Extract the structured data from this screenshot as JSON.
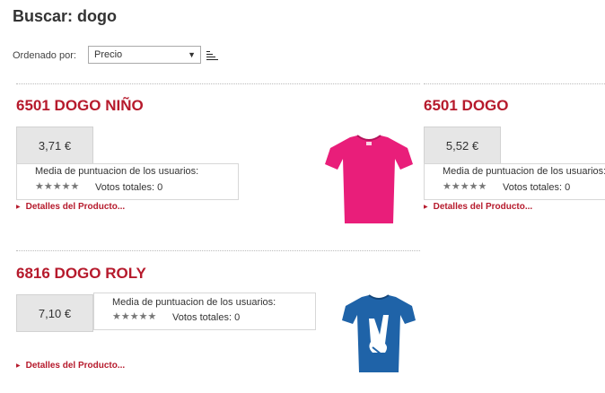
{
  "search": {
    "title": "Buscar: dogo"
  },
  "sort": {
    "label": "Ordenado por:",
    "selected": "Precio"
  },
  "icons": {
    "sort": "sort-order-icon",
    "dropdown": "dropdown-arrow-icon",
    "stars": "rating-stars-icon",
    "bullet": "triangle-bullet-icon"
  },
  "colors": {
    "accent": "#b61a2c",
    "price_bg": "#e6e6e6",
    "shirt_pink": "#e91e7a",
    "shirt_blue": "#1f63a8"
  },
  "products": [
    {
      "name": "6501 DOGO NIÑO",
      "price": "3,71 €",
      "rating_label": "Media de puntuacion de los usuarios:",
      "stars": "★★★★★",
      "votes": "Votos totales: 0",
      "details": "Detalles del Producto..."
    },
    {
      "name": "6501 DOGO",
      "price": "5,52 €",
      "rating_label": "Media de puntuacion de los usuarios:",
      "stars": "★★★★★",
      "votes": "Votos totales: 0",
      "details": "Detalles del Producto..."
    },
    {
      "name": "6816 DOGO ROLY",
      "price": "7,10 €",
      "rating_label": "Media de puntuacion de los usuarios:",
      "stars": "★★★★★",
      "votes": "Votos totales: 0",
      "details": "Detalles del Producto..."
    }
  ]
}
